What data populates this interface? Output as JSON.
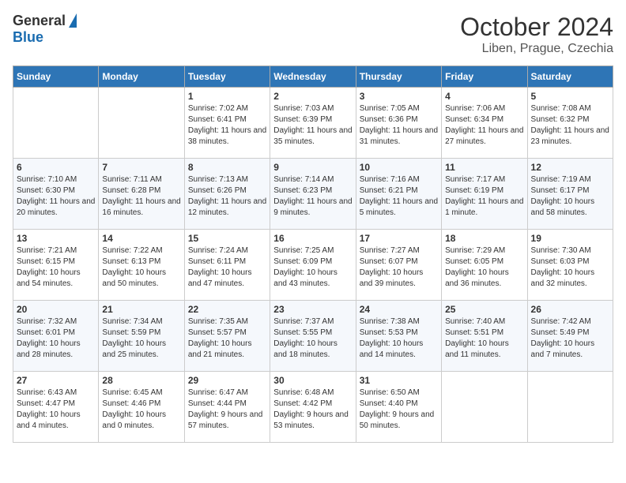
{
  "header": {
    "logo_general": "General",
    "logo_blue": "Blue",
    "month": "October 2024",
    "location": "Liben, Prague, Czechia"
  },
  "days_of_week": [
    "Sunday",
    "Monday",
    "Tuesday",
    "Wednesday",
    "Thursday",
    "Friday",
    "Saturday"
  ],
  "weeks": [
    [
      {
        "day": "",
        "info": ""
      },
      {
        "day": "",
        "info": ""
      },
      {
        "day": "1",
        "info": "Sunrise: 7:02 AM\nSunset: 6:41 PM\nDaylight: 11 hours and 38 minutes."
      },
      {
        "day": "2",
        "info": "Sunrise: 7:03 AM\nSunset: 6:39 PM\nDaylight: 11 hours and 35 minutes."
      },
      {
        "day": "3",
        "info": "Sunrise: 7:05 AM\nSunset: 6:36 PM\nDaylight: 11 hours and 31 minutes."
      },
      {
        "day": "4",
        "info": "Sunrise: 7:06 AM\nSunset: 6:34 PM\nDaylight: 11 hours and 27 minutes."
      },
      {
        "day": "5",
        "info": "Sunrise: 7:08 AM\nSunset: 6:32 PM\nDaylight: 11 hours and 23 minutes."
      }
    ],
    [
      {
        "day": "6",
        "info": "Sunrise: 7:10 AM\nSunset: 6:30 PM\nDaylight: 11 hours and 20 minutes."
      },
      {
        "day": "7",
        "info": "Sunrise: 7:11 AM\nSunset: 6:28 PM\nDaylight: 11 hours and 16 minutes."
      },
      {
        "day": "8",
        "info": "Sunrise: 7:13 AM\nSunset: 6:26 PM\nDaylight: 11 hours and 12 minutes."
      },
      {
        "day": "9",
        "info": "Sunrise: 7:14 AM\nSunset: 6:23 PM\nDaylight: 11 hours and 9 minutes."
      },
      {
        "day": "10",
        "info": "Sunrise: 7:16 AM\nSunset: 6:21 PM\nDaylight: 11 hours and 5 minutes."
      },
      {
        "day": "11",
        "info": "Sunrise: 7:17 AM\nSunset: 6:19 PM\nDaylight: 11 hours and 1 minute."
      },
      {
        "day": "12",
        "info": "Sunrise: 7:19 AM\nSunset: 6:17 PM\nDaylight: 10 hours and 58 minutes."
      }
    ],
    [
      {
        "day": "13",
        "info": "Sunrise: 7:21 AM\nSunset: 6:15 PM\nDaylight: 10 hours and 54 minutes."
      },
      {
        "day": "14",
        "info": "Sunrise: 7:22 AM\nSunset: 6:13 PM\nDaylight: 10 hours and 50 minutes."
      },
      {
        "day": "15",
        "info": "Sunrise: 7:24 AM\nSunset: 6:11 PM\nDaylight: 10 hours and 47 minutes."
      },
      {
        "day": "16",
        "info": "Sunrise: 7:25 AM\nSunset: 6:09 PM\nDaylight: 10 hours and 43 minutes."
      },
      {
        "day": "17",
        "info": "Sunrise: 7:27 AM\nSunset: 6:07 PM\nDaylight: 10 hours and 39 minutes."
      },
      {
        "day": "18",
        "info": "Sunrise: 7:29 AM\nSunset: 6:05 PM\nDaylight: 10 hours and 36 minutes."
      },
      {
        "day": "19",
        "info": "Sunrise: 7:30 AM\nSunset: 6:03 PM\nDaylight: 10 hours and 32 minutes."
      }
    ],
    [
      {
        "day": "20",
        "info": "Sunrise: 7:32 AM\nSunset: 6:01 PM\nDaylight: 10 hours and 28 minutes."
      },
      {
        "day": "21",
        "info": "Sunrise: 7:34 AM\nSunset: 5:59 PM\nDaylight: 10 hours and 25 minutes."
      },
      {
        "day": "22",
        "info": "Sunrise: 7:35 AM\nSunset: 5:57 PM\nDaylight: 10 hours and 21 minutes."
      },
      {
        "day": "23",
        "info": "Sunrise: 7:37 AM\nSunset: 5:55 PM\nDaylight: 10 hours and 18 minutes."
      },
      {
        "day": "24",
        "info": "Sunrise: 7:38 AM\nSunset: 5:53 PM\nDaylight: 10 hours and 14 minutes."
      },
      {
        "day": "25",
        "info": "Sunrise: 7:40 AM\nSunset: 5:51 PM\nDaylight: 10 hours and 11 minutes."
      },
      {
        "day": "26",
        "info": "Sunrise: 7:42 AM\nSunset: 5:49 PM\nDaylight: 10 hours and 7 minutes."
      }
    ],
    [
      {
        "day": "27",
        "info": "Sunrise: 6:43 AM\nSunset: 4:47 PM\nDaylight: 10 hours and 4 minutes."
      },
      {
        "day": "28",
        "info": "Sunrise: 6:45 AM\nSunset: 4:46 PM\nDaylight: 10 hours and 0 minutes."
      },
      {
        "day": "29",
        "info": "Sunrise: 6:47 AM\nSunset: 4:44 PM\nDaylight: 9 hours and 57 minutes."
      },
      {
        "day": "30",
        "info": "Sunrise: 6:48 AM\nSunset: 4:42 PM\nDaylight: 9 hours and 53 minutes."
      },
      {
        "day": "31",
        "info": "Sunrise: 6:50 AM\nSunset: 4:40 PM\nDaylight: 9 hours and 50 minutes."
      },
      {
        "day": "",
        "info": ""
      },
      {
        "day": "",
        "info": ""
      }
    ]
  ]
}
